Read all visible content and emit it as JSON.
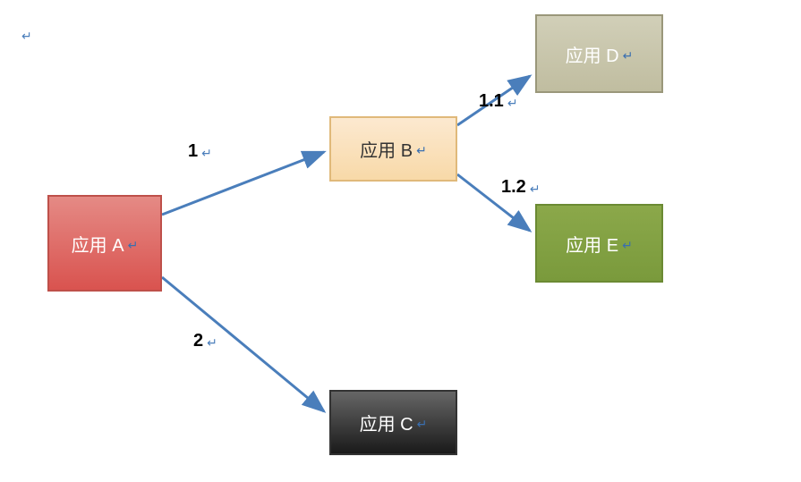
{
  "paragraph_mark": "↵",
  "return_mark": "↵",
  "nodes": {
    "a": {
      "label": "应用 A"
    },
    "b": {
      "label": "应用 B"
    },
    "c": {
      "label": "应用 C"
    },
    "d": {
      "label": "应用 D"
    },
    "e": {
      "label": "应用 E"
    }
  },
  "edges": {
    "ab": {
      "label": "1"
    },
    "ac": {
      "label": "2"
    },
    "bd": {
      "label": "1.1"
    },
    "be": {
      "label": "1.2"
    }
  },
  "arrow_color": "#4a7ebb"
}
